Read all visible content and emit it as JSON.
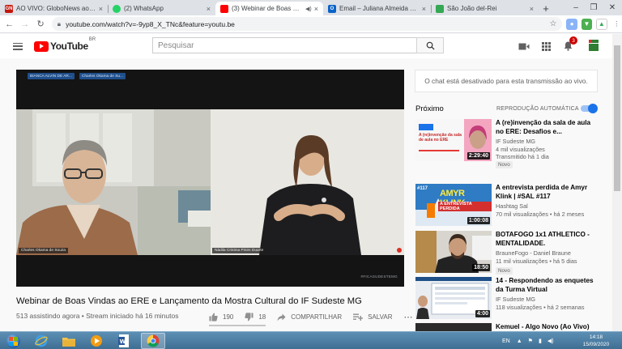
{
  "browser": {
    "tabs": [
      {
        "title": "AO VIVO: GloboNews ao vivo | G",
        "favicon_text": "GN",
        "favicon_color": "#c4170c"
      },
      {
        "title": "(2) WhatsApp",
        "favicon_text": "",
        "favicon_color": "#25d366"
      },
      {
        "title": "(3) Webinar de Boas Vindas",
        "favicon_text": "",
        "favicon_color": "#ff0000"
      },
      {
        "title": "Email – Juliana Almeida – Outlo",
        "favicon_text": "O",
        "favicon_color": "#0a64c8"
      },
      {
        "title": "São João del-Rei",
        "favicon_text": "",
        "favicon_color": "#34a853"
      }
    ],
    "url": "youtube.com/watch?v=-9yp8_X_TNc&feature=youtu.be"
  },
  "youtube": {
    "logo_text": "YouTube",
    "region": "BR",
    "search_placeholder": "Pesquisar",
    "notification_count": "3"
  },
  "player": {
    "chips": [
      "BIANCA ALVIN DE AR...",
      "Charles Okama de Su..."
    ],
    "left_name": "Charles Okama de Souza",
    "right_name": "Nádila Cristina Pinim Duarte",
    "watermark": "#FICASUDESTEMG"
  },
  "video": {
    "title": "Webinar de Boas Vindas ao ERE e Lançamento da Mostra Cultural do IF Sudeste MG",
    "meta": "513 assistindo agora • Stream iniciado há 16 minutos",
    "likes": "190",
    "dislikes": "18",
    "share_label": "COMPARTILHAR",
    "save_label": "SALVAR"
  },
  "sidebar": {
    "chat_disabled": "O chat está desativado para esta transmissão ao vivo.",
    "next_label": "Próximo",
    "autoplay_label": "REPRODUÇÃO AUTOMÁTICA",
    "recommendations": [
      {
        "title": "A (re)invenção da sala de aula no ERE: Desafios e...",
        "channel": "IF Sudeste MG",
        "views": "4 mil visualizações",
        "age": "Transmitido há 1 dia",
        "duration": "2:29:40",
        "badge": "Novo",
        "thumb_text": "A (re)invenção da sala de aula no ERE"
      },
      {
        "title": "A entrevista perdida de Amyr Klink | #SAL #117",
        "channel": "Hashtag Sal",
        "views": "70 mil visualizações",
        "age": "há 2 meses",
        "duration": "1:00:08",
        "badge": "",
        "thumb_text": "AMYR KLINK",
        "thumb_sub": "A ENTREVISTA PERDIDA",
        "thumb_num": "#117"
      },
      {
        "title": "BOTAFOGO 1x1 ATHLETICO - MENTALIDADE.",
        "channel": "BrauneFogo - Daniel Braune",
        "views": "11 mil visualizações",
        "age": "há 5 dias",
        "duration": "18:50",
        "badge": "Novo",
        "thumb_text": ""
      },
      {
        "title": "14 - Respondendo as enquetes da Turma Virtual",
        "channel": "IF Sudeste MG",
        "views": "118 visualizações",
        "age": "há 2 semanas",
        "duration": "4:00",
        "badge": "",
        "thumb_text": ""
      },
      {
        "title": "Kemuel - Algo Novo (Ao Vivo)",
        "channel": "",
        "views": "",
        "age": "",
        "duration": "",
        "badge": "",
        "thumb_text": ""
      }
    ]
  },
  "taskbar": {
    "language": "EN",
    "time": "14:18",
    "date": "15/09/2020"
  },
  "colors": {
    "accent": "#1a73e8",
    "youtube_red": "#ff0000"
  }
}
